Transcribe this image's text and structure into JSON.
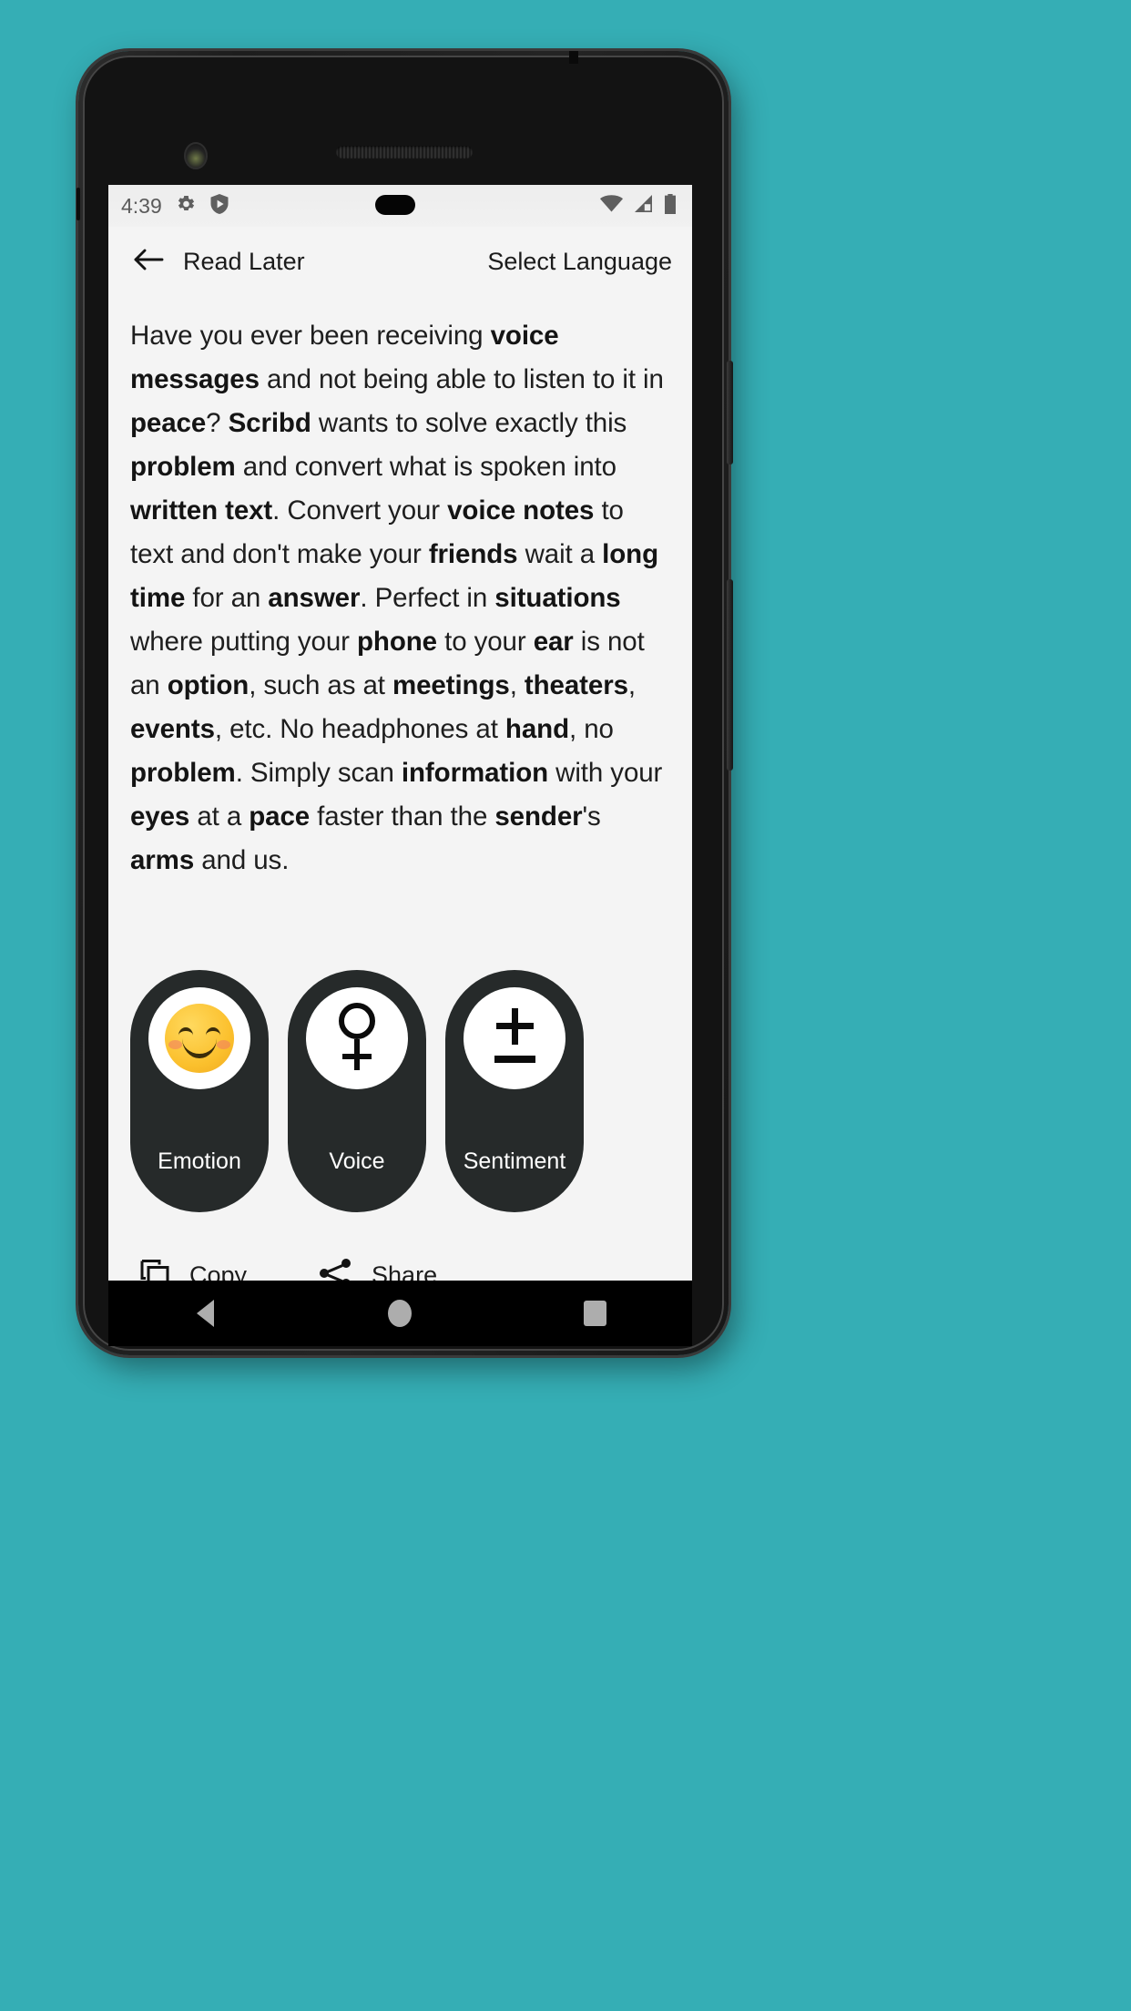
{
  "background": {
    "color": "#35AEB5"
  },
  "device": {
    "frame_color": "#1d1d1d",
    "screen_bg": "#F4F4F4",
    "hardware": {
      "front_camera": "front-camera",
      "earpiece": "earpiece-speaker",
      "power_button": "power-button",
      "volume_button": "volume-button"
    }
  },
  "status_bar": {
    "clock": "4:39",
    "left_icons": [
      "gear-icon",
      "shield-play-icon"
    ],
    "right_icons": [
      "wifi-icon",
      "cellular-signal-icon",
      "battery-icon"
    ],
    "text_color": "#5a5a5a"
  },
  "app_bar": {
    "back_icon": "arrow-left-icon",
    "title": "Read Later",
    "action_label": "Select Language"
  },
  "article": {
    "segments": [
      {
        "text": "Have you ever been receiving ",
        "bold": false
      },
      {
        "text": "voice messages",
        "bold": true
      },
      {
        "text": " and not being able to listen to it in ",
        "bold": false
      },
      {
        "text": "peace",
        "bold": true
      },
      {
        "text": "? ",
        "bold": false
      },
      {
        "text": "Scribd",
        "bold": true
      },
      {
        "text": " wants to solve exactly this ",
        "bold": false
      },
      {
        "text": "problem",
        "bold": true
      },
      {
        "text": " and convert what is spoken into ",
        "bold": false
      },
      {
        "text": "written text",
        "bold": true
      },
      {
        "text": ". Convert your ",
        "bold": false
      },
      {
        "text": "voice notes",
        "bold": true
      },
      {
        "text": " to text and don't make your ",
        "bold": false
      },
      {
        "text": "friends",
        "bold": true
      },
      {
        "text": " wait a ",
        "bold": false
      },
      {
        "text": "long time",
        "bold": true
      },
      {
        "text": " for an ",
        "bold": false
      },
      {
        "text": "answer",
        "bold": true
      },
      {
        "text": ". Perfect in ",
        "bold": false
      },
      {
        "text": "situations",
        "bold": true
      },
      {
        "text": " where putting your ",
        "bold": false
      },
      {
        "text": "phone",
        "bold": true
      },
      {
        "text": " to your ",
        "bold": false
      },
      {
        "text": "ear",
        "bold": true
      },
      {
        "text": " is not an ",
        "bold": false
      },
      {
        "text": "option",
        "bold": true
      },
      {
        "text": ", such as at ",
        "bold": false
      },
      {
        "text": "meetings",
        "bold": true
      },
      {
        "text": ", ",
        "bold": false
      },
      {
        "text": "theaters",
        "bold": true
      },
      {
        "text": ", ",
        "bold": false
      },
      {
        "text": "events",
        "bold": true
      },
      {
        "text": ", etc. No headphones at ",
        "bold": false
      },
      {
        "text": "hand",
        "bold": true
      },
      {
        "text": ", no ",
        "bold": false
      },
      {
        "text": "problem",
        "bold": true
      },
      {
        "text": ". Simply scan ",
        "bold": false
      },
      {
        "text": "information",
        "bold": true
      },
      {
        "text": " with your ",
        "bold": false
      },
      {
        "text": "eyes",
        "bold": true
      },
      {
        "text": " at a ",
        "bold": false
      },
      {
        "text": "pace",
        "bold": true
      },
      {
        "text": " faster than the ",
        "bold": false
      },
      {
        "text": "sender",
        "bold": true
      },
      {
        "text": "'s ",
        "bold": false
      },
      {
        "text": "arms",
        "bold": true
      },
      {
        "text": " and us.",
        "bold": false
      }
    ],
    "text_color": "#1e1e1e"
  },
  "analysis_pills": {
    "background_color": "#262A2A",
    "items": [
      {
        "label": "Emotion",
        "icon": "smiling-face-emoji-icon"
      },
      {
        "label": "Voice",
        "icon": "venus-female-symbol-icon"
      },
      {
        "label": "Sentiment",
        "icon": "plus-minus-symbol-icon"
      }
    ]
  },
  "bottom_actions": {
    "items": [
      {
        "label": "Copy",
        "icon": "copy-icon"
      },
      {
        "label": "Share",
        "icon": "share-icon"
      }
    ]
  },
  "nav_bar": {
    "background": "#000000",
    "icon_color": "#ADADAD",
    "buttons": [
      {
        "name": "back",
        "icon": "triangle-back-icon"
      },
      {
        "name": "home",
        "icon": "circle-home-icon"
      },
      {
        "name": "recents",
        "icon": "square-recents-icon"
      }
    ]
  }
}
